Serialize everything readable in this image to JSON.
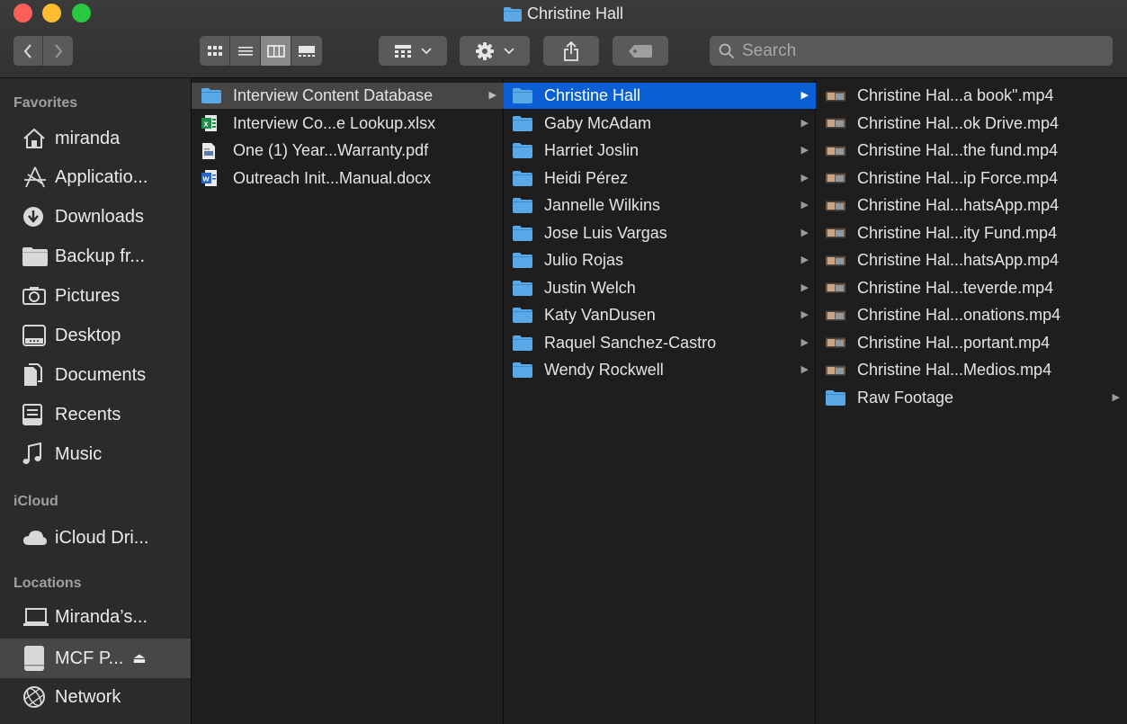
{
  "window": {
    "title": "Christine Hall"
  },
  "toolbar": {
    "back_icon": "chevron-left-icon",
    "forward_icon": "chevron-right-icon",
    "view_modes": [
      "icon-view",
      "list-view",
      "column-view",
      "gallery-view"
    ],
    "active_view": "column-view",
    "group_button": "group-icon",
    "action_button": "gear-icon",
    "share_button": "share-icon",
    "tag_button": "tag-icon",
    "search_placeholder": "Search"
  },
  "sidebar": {
    "sections": [
      {
        "heading": "Favorites",
        "items": [
          {
            "label": "miranda",
            "icon": "home-icon"
          },
          {
            "label": "Applicatio...",
            "icon": "applications-icon"
          },
          {
            "label": "Downloads",
            "icon": "downloads-icon"
          },
          {
            "label": "Backup fr...",
            "icon": "folder-icon"
          },
          {
            "label": "Pictures",
            "icon": "camera-icon"
          },
          {
            "label": "Desktop",
            "icon": "desktop-icon"
          },
          {
            "label": "Documents",
            "icon": "documents-icon"
          },
          {
            "label": "Recents",
            "icon": "recents-icon"
          },
          {
            "label": "Music",
            "icon": "music-icon"
          }
        ]
      },
      {
        "heading": "iCloud",
        "items": [
          {
            "label": "iCloud Dri...",
            "icon": "cloud-icon"
          }
        ]
      },
      {
        "heading": "Locations",
        "items": [
          {
            "label": "Miranda’s...",
            "icon": "laptop-icon"
          },
          {
            "label": "MCF P...",
            "icon": "drive-icon",
            "selected": true,
            "eject": "⏏"
          },
          {
            "label": "Network",
            "icon": "network-icon"
          }
        ]
      }
    ]
  },
  "columns": [
    {
      "items": [
        {
          "name": "Interview Content Database",
          "type": "folder",
          "selected": "grey",
          "expandable": true
        },
        {
          "name": "Interview Co...e Lookup.xlsx",
          "type": "xlsx"
        },
        {
          "name": "One (1) Year...Warranty.pdf",
          "type": "pdf"
        },
        {
          "name": "Outreach Init...Manual.docx",
          "type": "docx"
        }
      ]
    },
    {
      "items": [
        {
          "name": "Christine Hall",
          "type": "folder",
          "selected": "blue",
          "expandable": true
        },
        {
          "name": "Gaby McAdam",
          "type": "folder",
          "expandable": true
        },
        {
          "name": "Harriet Joslin",
          "type": "folder",
          "expandable": true
        },
        {
          "name": "Heidi Pérez",
          "type": "folder",
          "expandable": true
        },
        {
          "name": "Jannelle Wilkins",
          "type": "folder",
          "expandable": true
        },
        {
          "name": "Jose Luis Vargas",
          "type": "folder",
          "expandable": true
        },
        {
          "name": "Julio Rojas",
          "type": "folder",
          "expandable": true
        },
        {
          "name": "Justin Welch",
          "type": "folder",
          "expandable": true
        },
        {
          "name": "Katy VanDusen",
          "type": "folder",
          "expandable": true
        },
        {
          "name": "Raquel Sanchez-Castro",
          "type": "folder",
          "expandable": true
        },
        {
          "name": "Wendy Rockwell",
          "type": "folder",
          "expandable": true
        }
      ]
    },
    {
      "items": [
        {
          "name": "Christine Hal...a book\".mp4",
          "type": "video"
        },
        {
          "name": "Christine Hal...ok Drive.mp4",
          "type": "video"
        },
        {
          "name": "Christine Hal...the fund.mp4",
          "type": "video"
        },
        {
          "name": "Christine Hal...ip Force.mp4",
          "type": "video"
        },
        {
          "name": "Christine Hal...hatsApp.mp4",
          "type": "video"
        },
        {
          "name": "Christine Hal...ity Fund.mp4",
          "type": "video"
        },
        {
          "name": "Christine Hal...hatsApp.mp4",
          "type": "video"
        },
        {
          "name": "Christine Hal...teverde.mp4",
          "type": "video"
        },
        {
          "name": "Christine Hal...onations.mp4",
          "type": "video"
        },
        {
          "name": "Christine Hal...portant.mp4",
          "type": "video"
        },
        {
          "name": "Christine Hal...Medios.mp4",
          "type": "video"
        },
        {
          "name": "Raw Footage",
          "type": "folder",
          "expandable": true
        }
      ]
    }
  ],
  "colors": {
    "folder": "#5aa9e6",
    "selection_blue": "#0a5fd5",
    "selection_grey": "#464646",
    "close": "#fe5f57",
    "minimize": "#febc2e",
    "zoom": "#28c840"
  }
}
